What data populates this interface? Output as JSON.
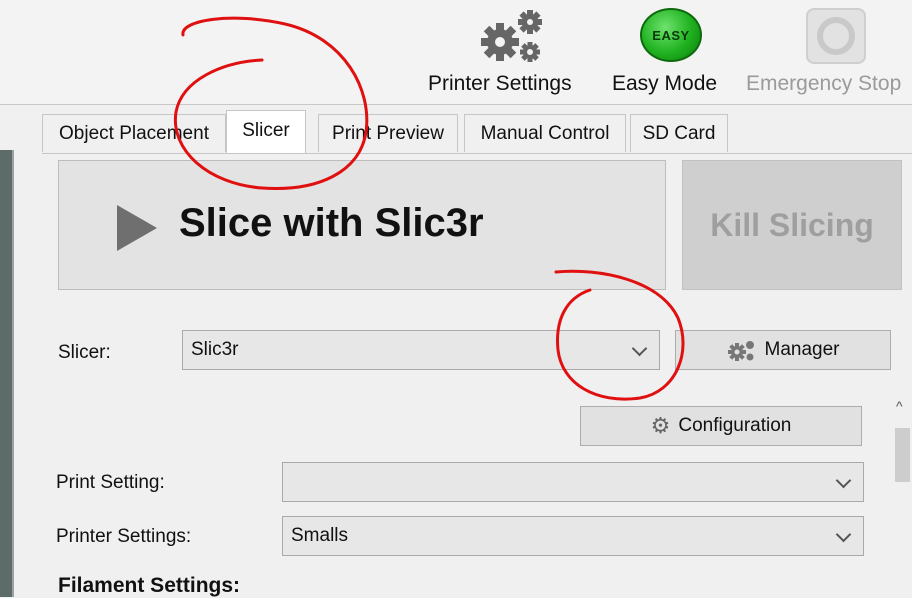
{
  "toolbar": {
    "printer_settings": "Printer Settings",
    "easy_mode": "Easy Mode",
    "easy_badge": "EASY",
    "emergency_stop": "Emergency Stop"
  },
  "tabs": [
    {
      "label": "Object Placement"
    },
    {
      "label": "Slicer"
    },
    {
      "label": "Print Preview"
    },
    {
      "label": "Manual Control"
    },
    {
      "label": "SD Card"
    }
  ],
  "slicer_panel": {
    "slice_button": "Slice with Slic3r",
    "kill_button": "Kill Slicing",
    "slicer_label": "Slicer:",
    "slicer_value": "Slic3r",
    "manager_button": "Manager",
    "configuration_button": "Configuration",
    "print_setting_label": "Print Setting:",
    "print_setting_value": "",
    "printer_settings_label": "Printer Settings:",
    "printer_settings_value": "Smalls",
    "filament_heading": "Filament Settings:"
  },
  "colors": {
    "annotation": "#e01010",
    "easy_green": "#1fb11f"
  }
}
